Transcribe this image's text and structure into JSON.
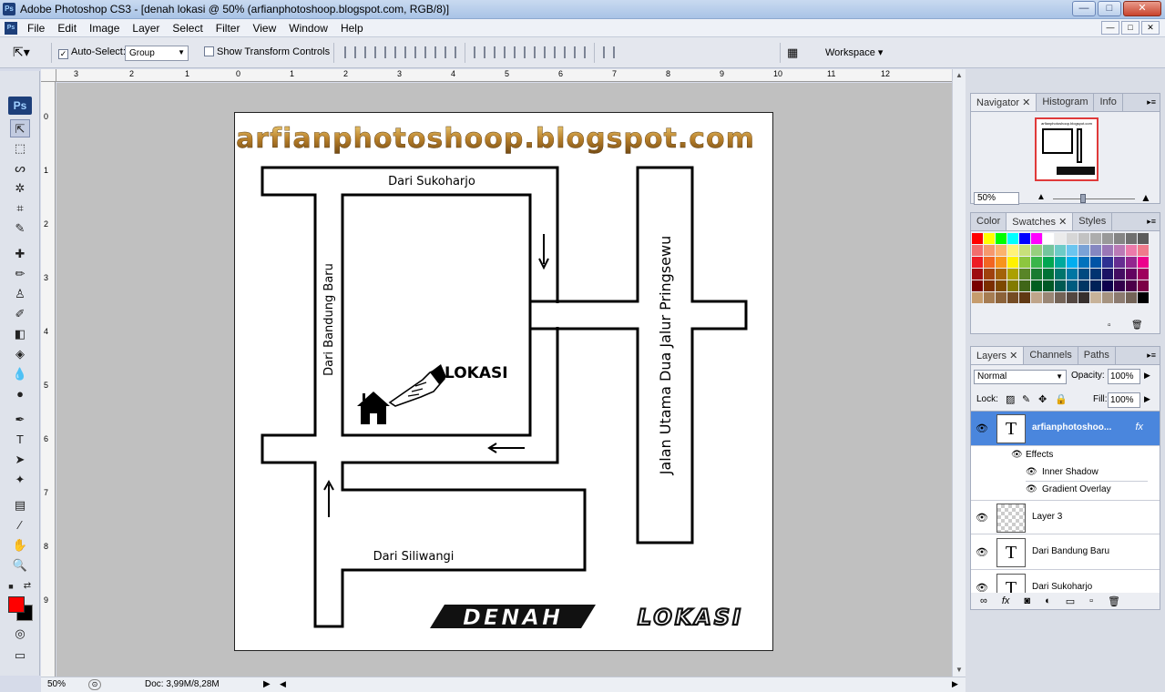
{
  "window": {
    "title": "Adobe Photoshop CS3 - [denah lokasi @ 50% (arfianphotoshoop.blogspot.com, RGB/8)]",
    "logo": "Ps",
    "min_label": "—",
    "max_label": "□",
    "close_label": "✕"
  },
  "menu": [
    "File",
    "Edit",
    "Image",
    "Layer",
    "Select",
    "Filter",
    "View",
    "Window",
    "Help"
  ],
  "options": {
    "auto_select_label": "Auto-Select:",
    "auto_select_value": "Group",
    "show_transform_label": "Show Transform Controls",
    "workspace_label": "Workspace ▾"
  },
  "toolbox": {
    "badge": "Ps"
  },
  "rulers": {
    "h": [
      "3",
      "2",
      "1",
      "0",
      "1",
      "2",
      "3",
      "4",
      "5",
      "6",
      "7",
      "8",
      "9",
      "10",
      "11",
      "12"
    ],
    "v": [
      "0",
      "1",
      "2",
      "3",
      "4",
      "5",
      "6",
      "7",
      "8",
      "9"
    ]
  },
  "map": {
    "blog_title": "arfianphotoshoop.blogspot.com",
    "road_sukoharjo": "Dari Sukoharjo",
    "road_bandung": "Dari Bandung Baru",
    "road_jalan_utama": "Jalan Utama Dua Jalur Pringsewu",
    "road_siliwangi": "Dari Siliwangi",
    "location_label": "LOKASI",
    "logo_word1": "DENAH",
    "logo_word2": "LOKASI"
  },
  "status": {
    "zoom": "50%",
    "doc": "Doc: 3,99M/8,28M"
  },
  "navigator": {
    "tabs": [
      "Navigator",
      "Histogram",
      "Info"
    ],
    "zoom": "50%",
    "thumb_title": "arfianphotoshoop.blogspot.com"
  },
  "swatches": {
    "tabs": [
      "Color",
      "Swatches",
      "Styles"
    ],
    "colors": [
      "#ff0000",
      "#ffff00",
      "#00ff00",
      "#00ffff",
      "#0000ff",
      "#ff00ff",
      "#ffffff",
      "#ebebeb",
      "#d6d6d6",
      "#c2c2c2",
      "#adadad",
      "#999999",
      "#858585",
      "#707070",
      "#5c5c5c",
      "#f26d6d",
      "#f6986d",
      "#fbb36d",
      "#fff37a",
      "#c8e07a",
      "#97cf7e",
      "#74c59d",
      "#6dcbc7",
      "#6bc5ef",
      "#7aa2d6",
      "#8587c1",
      "#9977b6",
      "#ba7ab6",
      "#ec7aab",
      "#ef7a8c",
      "#ed1c24",
      "#f26522",
      "#f7941d",
      "#fff200",
      "#8dc63f",
      "#39b54a",
      "#00a651",
      "#00a99d",
      "#00aeef",
      "#0072bc",
      "#0054a6",
      "#2e3192",
      "#662d91",
      "#92278f",
      "#ec008c",
      "#9e0b0f",
      "#a0410d",
      "#a36209",
      "#aba000",
      "#598527",
      "#197b30",
      "#007236",
      "#00746b",
      "#0076a3",
      "#004a80",
      "#003471",
      "#1b1464",
      "#440e62",
      "#630460",
      "#9e005d",
      "#790000",
      "#7b2e00",
      "#7d4900",
      "#827b00",
      "#406618",
      "#005e20",
      "#005826",
      "#005952",
      "#005b7f",
      "#003663",
      "#002157",
      "#0d004c",
      "#32004b",
      "#4b0049",
      "#7b0046",
      "#c69c6d",
      "#a67c52",
      "#8c6239",
      "#754c24",
      "#603913",
      "#bfa58a",
      "#998675",
      "#736357",
      "#534741",
      "#362f2d",
      "#c7b299",
      "#a69380",
      "#8c7b70",
      "#736357",
      "#000000"
    ]
  },
  "layers": {
    "tabs": [
      "Layers",
      "Channels",
      "Paths"
    ],
    "blend": "Normal",
    "opacity_label": "Opacity:",
    "opacity": "100%",
    "lock_label": "Lock:",
    "fill_label": "Fill:",
    "fill": "100%",
    "items": [
      {
        "name": "arfianphotoshoo...",
        "thumb": "T",
        "fx": "fx"
      },
      {
        "name": "Layer 3",
        "thumb": ""
      },
      {
        "name": "Dari Bandung Baru",
        "thumb": "T"
      },
      {
        "name": "Dari Sukoharjo",
        "thumb": "T"
      }
    ],
    "effects_label": "Effects",
    "effect_1": "Inner Shadow",
    "effect_2": "Gradient Overlay"
  }
}
